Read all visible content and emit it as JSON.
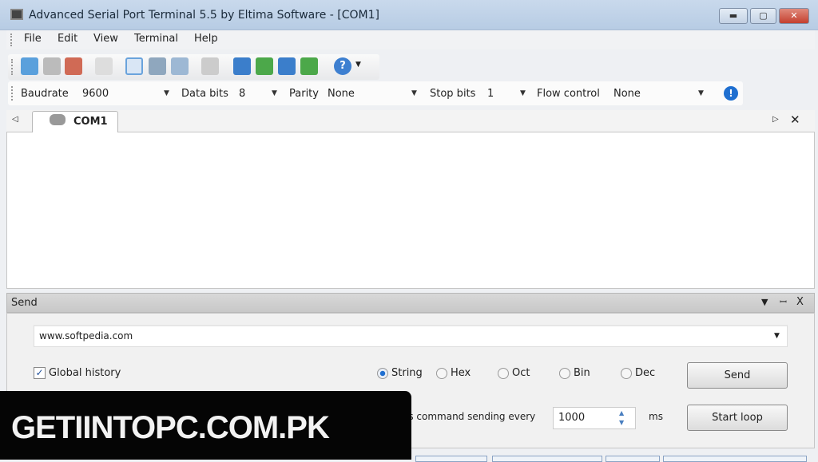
{
  "window": {
    "title": "Advanced Serial Port Terminal 5.5 by Eltima Software - [COM1]"
  },
  "menu": [
    "File",
    "Edit",
    "View",
    "Terminal",
    "Help"
  ],
  "toolbar": {
    "icons": [
      "new-session-icon",
      "connect-icon",
      "disconnect-icon",
      "copy-icon",
      "paste-icon",
      "view-text-icon",
      "view-hex-icon",
      "view-dump-icon",
      "clear-icon",
      "send-file-icon",
      "receive-file-icon",
      "send-macro-icon",
      "receive-macro-icon",
      "help-icon"
    ]
  },
  "params": {
    "baudrate_label": "Baudrate",
    "baudrate": "9600",
    "databits_label": "Data bits",
    "databits": "8",
    "parity_label": "Parity",
    "parity": "None",
    "stopbits_label": "Stop bits",
    "stopbits": "1",
    "flow_label": "Flow control",
    "flow": "None"
  },
  "tabs": [
    {
      "label": "COM1"
    }
  ],
  "send": {
    "header": "Send",
    "command": "www.softpedia.com",
    "global_history": "Global history",
    "global_history_checked": true,
    "formats": [
      "String",
      "Hex",
      "Oct",
      "Bin",
      "Dec"
    ],
    "selected_format": "String",
    "send_label": "Send",
    "loop_text": "is command sending every",
    "interval": "1000",
    "unit": "ms",
    "start_loop_label": "Start loop"
  },
  "watermark": "GETIINTOPC.COM.PK",
  "colors": {
    "accent": "#1f6fd0",
    "titlebar": "#c0d3ea",
    "close": "#c8463b"
  }
}
